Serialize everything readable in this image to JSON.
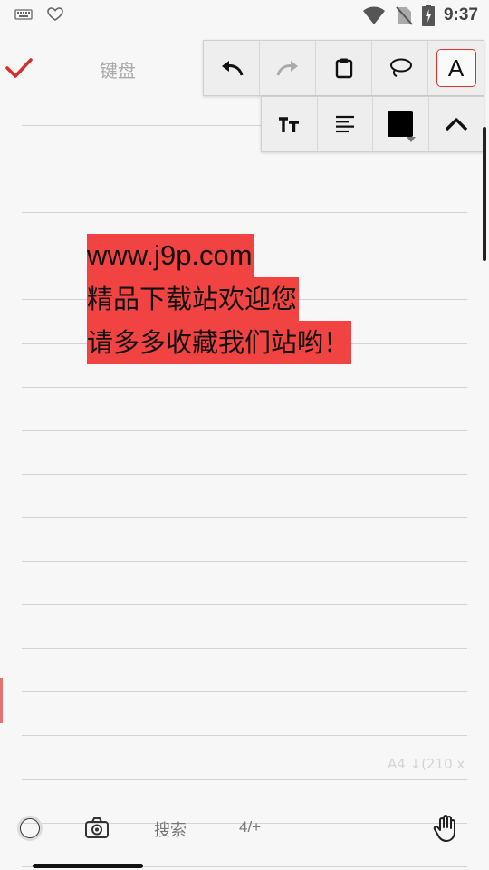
{
  "status_bar": {
    "time": "9:37",
    "left_icons": [
      "keyboard-icon",
      "heart-icon"
    ],
    "right_icons": [
      "wifi-icon",
      "no-sim-icon",
      "battery-charging-icon"
    ]
  },
  "header": {
    "confirm_icon": "check-icon",
    "keyboard_label": "键盘"
  },
  "toolbar": {
    "row1": [
      "undo-icon",
      "redo-icon",
      "clipboard-icon",
      "lasso-icon",
      "text-mode-icon"
    ],
    "text_mode_label": "A",
    "row2": [
      "text-size-icon",
      "align-left-icon",
      "color-picker-icon",
      "collapse-icon"
    ],
    "current_color": "#000000"
  },
  "note": {
    "lines": [
      "www.j9p.com",
      "精品下载站欢迎您",
      "请多多收藏我们站哟！"
    ],
    "highlight_color": "#f24343"
  },
  "page_info": "A4 ↓(210 x",
  "bottom_bar": {
    "search_label": "搜索",
    "page_count": "4/+",
    "icons": [
      "pen-circle-icon",
      "camera-icon",
      "hand-icon"
    ]
  }
}
